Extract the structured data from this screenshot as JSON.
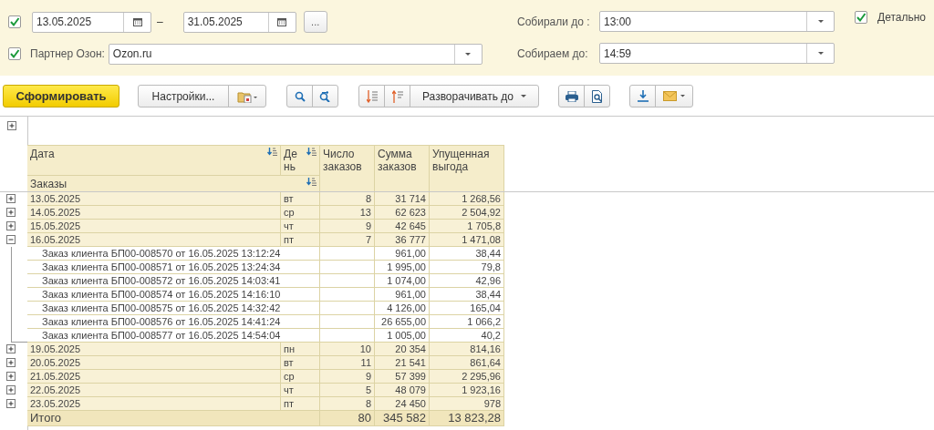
{
  "filters": {
    "period": {
      "checked": true,
      "date_from": "13.05.2025",
      "separator": "–",
      "date_to": "31.05.2025",
      "more_button": "..."
    },
    "partner": {
      "checked": true,
      "label": "Партнер Озон:",
      "value": "Ozon.ru"
    },
    "collected": {
      "label": "Собирали до :",
      "value": "13:00"
    },
    "collecting": {
      "label": "Собираем до:",
      "value": "14:59"
    },
    "detail": {
      "checked": true,
      "label": "Детально"
    }
  },
  "toolbar": {
    "generate_button": "Сформировать",
    "settings_button": "Настройки...",
    "expand_to_button": "Разворачивать до"
  },
  "table": {
    "columns": {
      "date": "Дата",
      "day": "День",
      "orders": "Заказы",
      "count": "Число заказов",
      "sum": "Сумма заказов",
      "lost": "Упущенная выгода"
    },
    "rows": [
      {
        "date": "13.05.2025",
        "day": "вт",
        "count": "8",
        "sum": "31 714",
        "lost": "1 268,56",
        "expanded": false
      },
      {
        "date": "14.05.2025",
        "day": "ср",
        "count": "13",
        "sum": "62 623",
        "lost": "2 504,92",
        "expanded": false
      },
      {
        "date": "15.05.2025",
        "day": "чт",
        "count": "9",
        "sum": "42 645",
        "lost": "1 705,8",
        "expanded": false
      },
      {
        "date": "16.05.2025",
        "day": "пт",
        "count": "7",
        "sum": "36 777",
        "lost": "1 471,08",
        "expanded": true,
        "children": [
          {
            "order": "Заказ клиента БП00-008570 от 16.05.2025 13:12:24",
            "sum": "961,00",
            "lost": "38,44"
          },
          {
            "order": "Заказ клиента БП00-008571 от 16.05.2025 13:24:34",
            "sum": "1 995,00",
            "lost": "79,8"
          },
          {
            "order": "Заказ клиента БП00-008572 от 16.05.2025 14:03:41",
            "sum": "1 074,00",
            "lost": "42,96"
          },
          {
            "order": "Заказ клиента БП00-008574 от 16.05.2025 14:16:10",
            "sum": "961,00",
            "lost": "38,44"
          },
          {
            "order": "Заказ клиента БП00-008575 от 16.05.2025 14:32:42",
            "sum": "4 126,00",
            "lost": "165,04"
          },
          {
            "order": "Заказ клиента БП00-008576 от 16.05.2025 14:41:24",
            "sum": "26 655,00",
            "lost": "1 066,2"
          },
          {
            "order": "Заказ клиента БП00-008577 от 16.05.2025 14:54:04",
            "sum": "1 005,00",
            "lost": "40,2"
          }
        ]
      },
      {
        "date": "19.05.2025",
        "day": "пн",
        "count": "10",
        "sum": "20 354",
        "lost": "814,16",
        "expanded": false
      },
      {
        "date": "20.05.2025",
        "day": "вт",
        "count": "11",
        "sum": "21 541",
        "lost": "861,64",
        "expanded": false
      },
      {
        "date": "21.05.2025",
        "day": "ср",
        "count": "9",
        "sum": "57 399",
        "lost": "2 295,96",
        "expanded": false
      },
      {
        "date": "22.05.2025",
        "day": "чт",
        "count": "5",
        "sum": "48 079",
        "lost": "1 923,16",
        "expanded": false
      },
      {
        "date": "23.05.2025",
        "day": "пт",
        "count": "8",
        "sum": "24 450",
        "lost": "978",
        "expanded": false
      }
    ],
    "total": {
      "label": "Итого",
      "count": "80",
      "sum": "345 582",
      "lost": "13 823,28"
    }
  }
}
